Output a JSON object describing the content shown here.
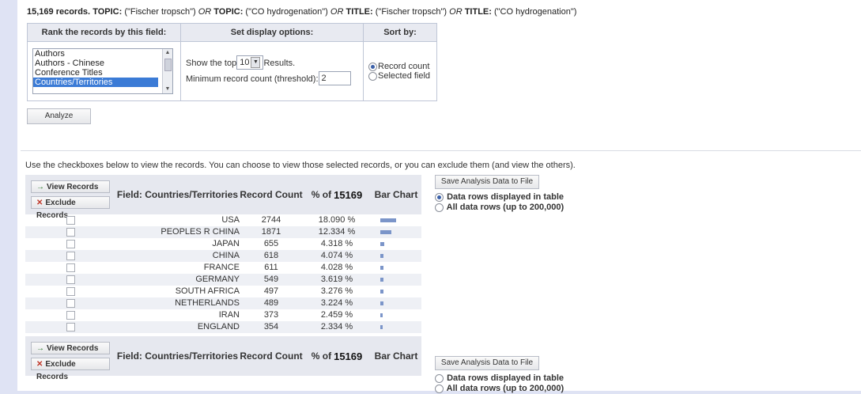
{
  "query": {
    "count": "15,169 records.",
    "part1_label": "TOPIC:",
    "part1_value": "(\"Fischer tropsch\")",
    "op1": "OR",
    "part2_label": "TOPIC:",
    "part2_value": "(\"CO hydrogenation\")",
    "op2": "OR",
    "part3_label": "TITLE:",
    "part3_value": "(\"Fischer tropsch\")",
    "op3": "OR",
    "part4_label": "TITLE:",
    "part4_value": "(\"CO hydrogenation\")"
  },
  "options": {
    "rank_header": "Rank the records by this field:",
    "display_header": "Set display options:",
    "sort_header": "Sort by:",
    "fields": [
      "Authors",
      "Authors - Chinese",
      "Conference Titles",
      "Countries/Territories"
    ],
    "selected_field": "Countries/Territories",
    "show_top_prefix": "Show the top",
    "show_top_value": "10",
    "show_top_suffix": "Results.",
    "threshold_label": "Minimum record count (threshold):",
    "threshold_value": "2",
    "sort_options": [
      "Record count",
      "Selected field"
    ],
    "sort_selected": "Record count",
    "analyze_label": "Analyze"
  },
  "hint": "Use the checkboxes below to view the records. You can choose to view those selected records, or you can exclude them (and view the others).",
  "table": {
    "view_label": "View Records",
    "exclude_label": "Exclude Records",
    "field_header": "Field: Countries/Territories",
    "count_header": "Record Count",
    "pct_header_prefix": "% of",
    "pct_header_total": "15169",
    "bar_header": "Bar Chart",
    "save_label": "Save Analysis Data to File",
    "save_options": [
      "Data rows displayed in table",
      "All data rows (up to 200,000)"
    ],
    "save_selected_top": "Data rows displayed in table",
    "rows": [
      {
        "name": "USA",
        "count": "2744",
        "pct": "18.090 %",
        "pct_value": 18.09
      },
      {
        "name": "PEOPLES R CHINA",
        "count": "1871",
        "pct": "12.334 %",
        "pct_value": 12.334
      },
      {
        "name": "JAPAN",
        "count": "655",
        "pct": "4.318 %",
        "pct_value": 4.318
      },
      {
        "name": "CHINA",
        "count": "618",
        "pct": "4.074 %",
        "pct_value": 4.074
      },
      {
        "name": "FRANCE",
        "count": "611",
        "pct": "4.028 %",
        "pct_value": 4.028
      },
      {
        "name": "GERMANY",
        "count": "549",
        "pct": "3.619 %",
        "pct_value": 3.619
      },
      {
        "name": "SOUTH AFRICA",
        "count": "497",
        "pct": "3.276 %",
        "pct_value": 3.276
      },
      {
        "name": "NETHERLANDS",
        "count": "489",
        "pct": "3.224 %",
        "pct_value": 3.224
      },
      {
        "name": "IRAN",
        "count": "373",
        "pct": "2.459 %",
        "pct_value": 2.459
      },
      {
        "name": "ENGLAND",
        "count": "354",
        "pct": "2.334 %",
        "pct_value": 2.334
      }
    ]
  },
  "colors": {
    "bar": "#7b95c9",
    "selected_item": "#3b7bd6",
    "header_bg": "#e6e8ef",
    "page_bg": "#dfe3f4"
  }
}
